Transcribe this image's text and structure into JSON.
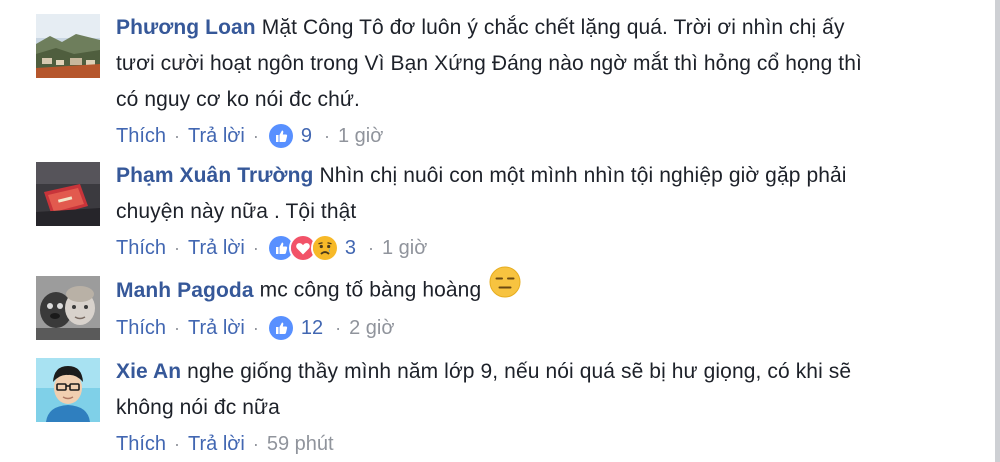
{
  "comments": [
    {
      "author": "Phương Loan",
      "text_lines": [
        "Mặt Công Tô đơ luôn ý chắc chết lặng quá. Trời ơi nhìn chị ấy",
        "tươi cười hoạt ngôn trong Vì Bạn Xứng Đáng nào ngờ mắt thì hỏng cổ họng thì",
        "có nguy cơ ko nói đc chứ."
      ],
      "like_label": "Thích",
      "reply_label": "Trả lời",
      "reaction_count": "9",
      "reaction_icons": [
        "like-icon"
      ],
      "time": "1 giờ"
    },
    {
      "author": "Phạm Xuân Trường",
      "text_lines": [
        "Nhìn chị nuôi con một mình nhìn tội nghiệp giờ gặp phải",
        "chuyện này nữa . Tội thật"
      ],
      "like_label": "Thích",
      "reply_label": "Trả lời",
      "reaction_count": "3",
      "reaction_icons": [
        "like-icon",
        "love-icon",
        "sad-icon"
      ],
      "time": "1 giờ"
    },
    {
      "author": "Manh Pagoda",
      "text_lines": [
        "mc công tố bàng hoàng"
      ],
      "inline_emoji": "expressionless-face-icon",
      "like_label": "Thích",
      "reply_label": "Trả lời",
      "reaction_count": "12",
      "reaction_icons": [
        "like-icon"
      ],
      "time": "2 giờ"
    },
    {
      "author": "Xie An",
      "text_lines": [
        "nghe giống thầy mình năm lớp 9, nếu nói quá sẽ bị hư giọng, có khi sẽ",
        "không nói đc nữa"
      ],
      "like_label": "Thích",
      "reply_label": "Trả lời",
      "time": "59 phút"
    }
  ],
  "colors": {
    "author": "#365899",
    "link": "#4267b2",
    "meta": "#90949c",
    "text": "#1d2129",
    "like_blue": "#5890ff",
    "love_red": "#f25268",
    "sad_yellow": "#f7b928"
  }
}
